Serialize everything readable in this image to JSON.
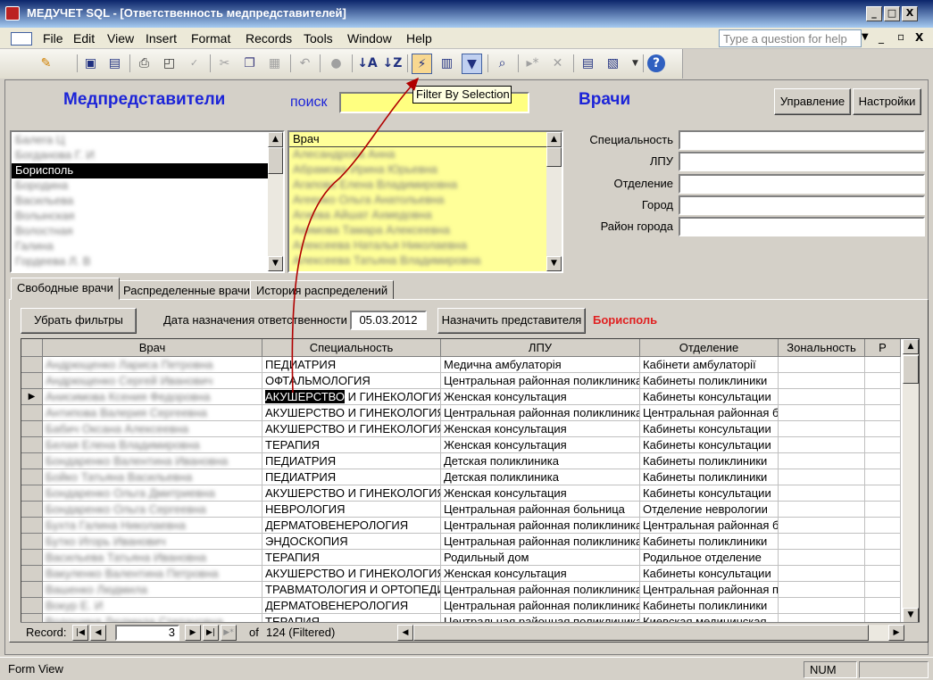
{
  "window": {
    "title": "МЕДУЧЕТ SQL - [Ответственность медпредставителей]",
    "app_icon": "access-app-icon",
    "controls": [
      "_",
      "□",
      "X"
    ]
  },
  "menubar": {
    "items": [
      "File",
      "Edit",
      "View",
      "Insert",
      "Format",
      "Records",
      "Tools",
      "Window",
      "Help"
    ],
    "help_placeholder": "Type a question for help",
    "doc_controls": [
      "_",
      "▫",
      "X"
    ]
  },
  "toolbar": {
    "tooltip": "Filter By Selection",
    "icons": [
      "view-icon",
      "save-icon",
      "save-as-icon",
      "print-icon",
      "print-preview-icon",
      "spelling-icon",
      "cut-icon",
      "copy-icon",
      "paste-icon",
      "undo-icon",
      "hyperlink-icon",
      "sort-ascending-icon",
      "sort-descending-icon",
      "filter-by-selection-icon",
      "filter-by-form-icon",
      "apply-filter-icon",
      "find-icon",
      "new-record-icon",
      "delete-record-icon",
      "database-window-icon",
      "new-object-icon",
      "help-icon"
    ]
  },
  "form": {
    "reps_header": "Медпредставители",
    "search_label": "поиск",
    "search_value": "",
    "doctors_header": "Врачи",
    "manage_button": "Управление",
    "settings_button": "Настройки",
    "reps_list": [
      {
        "text": "Балега Ц",
        "blurred": true,
        "selected": false
      },
      {
        "text": "Богданова Г. И",
        "blurred": true,
        "selected": false
      },
      {
        "text": "Борисполь",
        "blurred": false,
        "selected": true
      },
      {
        "text": "Бородина",
        "blurred": true,
        "selected": false
      },
      {
        "text": "Васильева",
        "blurred": true,
        "selected": false
      },
      {
        "text": "Волынская",
        "blurred": true,
        "selected": false
      },
      {
        "text": "Волостная",
        "blurred": true,
        "selected": false
      },
      {
        "text": "Галина",
        "blurred": true,
        "selected": false
      },
      {
        "text": "Гордеева Л. В",
        "blurred": true,
        "selected": false
      }
    ],
    "doctors_list": {
      "header": "Врач",
      "items": [
        "Алесандрова Анна",
        "Абрамова Ирина Юрьевна",
        "Агапова Елена Владимировна",
        "Агеенко Ольга Анатольевна",
        "Агиева Айшат Ахмедовна",
        "Акимова Тамара Алексеевна",
        "Алексеева Наталья Николаевна",
        "Алексеева Татьяна Владимировна"
      ]
    },
    "fields": [
      {
        "label": "Специальность",
        "value": ""
      },
      {
        "label": "ЛПУ",
        "value": ""
      },
      {
        "label": "Отделение",
        "value": ""
      },
      {
        "label": "Город",
        "value": ""
      },
      {
        "label": "Район города",
        "value": ""
      }
    ],
    "tabs": [
      "Свободные врачи",
      "Распределенные врачи",
      "История распределений"
    ],
    "remove_filters_button": "Убрать фильтры",
    "date_label": "Дата назначения ответственности",
    "date_value": "05.03.2012",
    "assign_button": "Назначить представителя",
    "assigned_rep": "Борисполь",
    "assigned_rep_color": "#e02020",
    "header_color": "#1c24d8",
    "grid": {
      "columns": [
        "Врач",
        "Специальность",
        "ЛПУ",
        "Отделение",
        "Зональность",
        "Р"
      ],
      "rows": [
        [
          "Андрющенко Лариса Петровна",
          "ПЕДИАТРИЯ",
          "Медична амбулаторія",
          "Кабінети амбулаторії"
        ],
        [
          "Андрющенко Сергей Иванович",
          "ОФТАЛЬМОЛОГИЯ",
          "Центральная районная поликлиника",
          "Кабинеты поликлиники"
        ],
        [
          "Анисимова Ксения Федоровна",
          "АКУШЕРСТВО И ГИНЕКОЛОГИЯ",
          "Женская консультация",
          "Кабинеты консультации"
        ],
        [
          "Антипова Валерия Сергеевна",
          "АКУШЕРСТВО И ГИНЕКОЛОГИЯ",
          "Центральная районная поликлиника",
          "Центральная районная б"
        ],
        [
          "Бабич Оксана Алексеевна",
          "АКУШЕРСТВО И ГИНЕКОЛОГИЯ",
          "Женская консультация",
          "Кабинеты консультации"
        ],
        [
          "Белая Елена Владимировна",
          "ТЕРАПИЯ",
          "Женская консультация",
          "Кабинеты консультации"
        ],
        [
          "Бондаренко Валентина Ивановна",
          "ПЕДИАТРИЯ",
          "Детская поликлиника",
          "Кабинеты поликлиники"
        ],
        [
          "Бойко Татьяна Васильевна",
          "ПЕДИАТРИЯ",
          "Детская поликлиника",
          "Кабинеты поликлиники"
        ],
        [
          "Бондаренко Ольга Дмитриевна",
          "АКУШЕРСТВО И ГИНЕКОЛОГИЯ",
          "Женская консультация",
          "Кабинеты консультации"
        ],
        [
          "Бондаренко Ольга Сергеевна",
          "НЕВРОЛОГИЯ",
          "Центральная районная больница",
          "Отделение неврологии"
        ],
        [
          "Бухта Галина Николаевна",
          "ДЕРМАТОВЕНЕРОЛОГИЯ",
          "Центральная районная поликлиника",
          "Центральная районная б"
        ],
        [
          "Бутко Игорь Иванович",
          "ЭНДОСКОПИЯ",
          "Центральная районная поликлиника",
          "Кабинеты поликлиники"
        ],
        [
          "Васильева Татьяна Ивановна",
          "ТЕРАПИЯ",
          "Родильный дом",
          "Родильное отделение"
        ],
        [
          "Вакуленко Валентина Петровна",
          "АКУШЕРСТВО И ГИНЕКОЛОГИЯ",
          "Женская консультация",
          "Кабинеты консультации"
        ],
        [
          "Вашенко Людмила",
          "ТРАВМАТОЛОГИЯ И ОРТОПЕДИЯ",
          "Центральная районная поликлиника",
          "Центральная районная п"
        ],
        [
          "Вокур Е. И",
          "ДЕРМАТОВЕНЕРОЛОГИЯ",
          "Центральная районная поликлиника",
          "Кабинеты поликлиники"
        ],
        [
          "Волошина Людмила Степановна",
          "ТЕРАПИЯ",
          "Центральная районная поликлиника",
          "Киевская медицинская"
        ]
      ],
      "current_row": 2,
      "selected_cell_text": "АКУШЕРСТВО"
    },
    "navigation": {
      "label": "Record:",
      "current": "3",
      "of_text": "of",
      "total": "124 (Filtered)"
    }
  },
  "statusbar": {
    "mode": "Form View",
    "num": "NUM"
  }
}
